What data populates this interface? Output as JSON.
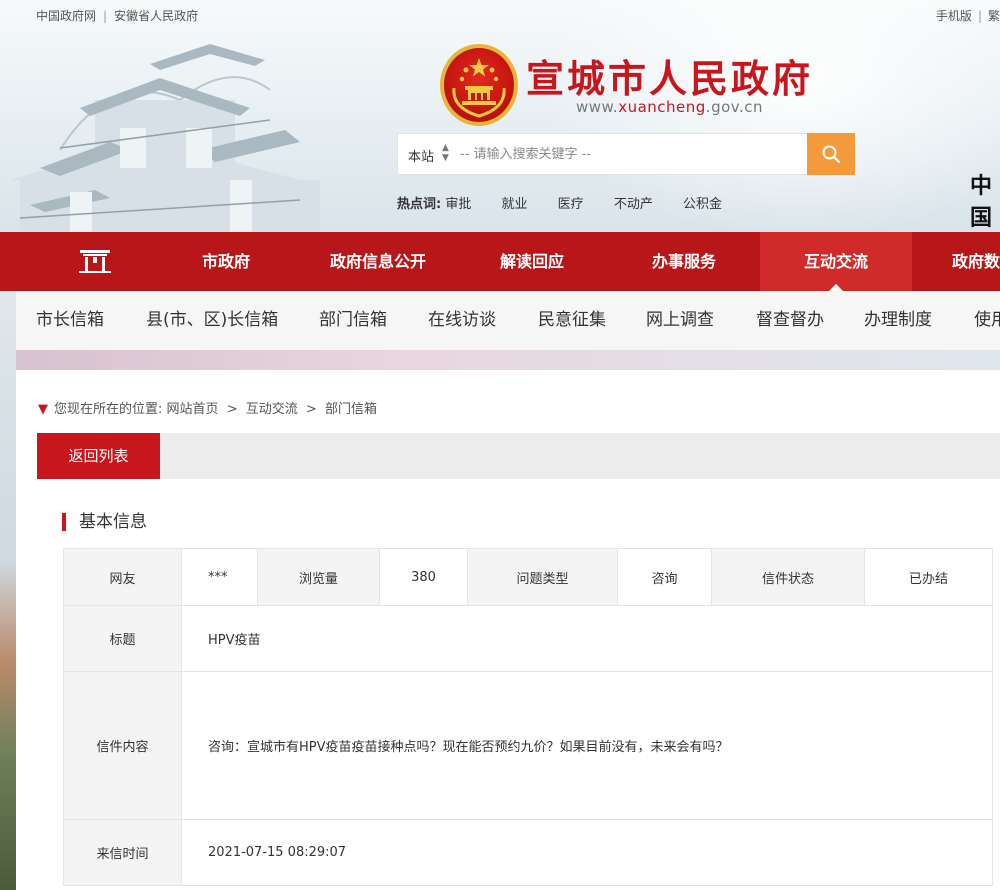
{
  "topbar": {
    "links": [
      "中国政府网",
      "安徽省人民政府"
    ],
    "right": [
      "手机版",
      "繁"
    ]
  },
  "site": {
    "title": "宣城市人民政府",
    "url_prefix": "www.",
    "url_brand": "xuancheng",
    "url_suffix": ".gov.cn",
    "side_text": "中国"
  },
  "search": {
    "scope": "本站",
    "placeholder": "-- 请输入搜索关键字 --"
  },
  "hot": {
    "label": "热点词:",
    "words": [
      "审批",
      "就业",
      "医疗",
      "不动产",
      "公积金"
    ]
  },
  "mainnav": {
    "items": [
      "市政府",
      "政府信息公开",
      "解读回应",
      "办事服务",
      "互动交流",
      "政府数"
    ],
    "active_index": 4
  },
  "subnav": {
    "items": [
      "市长信箱",
      "县(市、区)长信箱",
      "部门信箱",
      "在线访谈",
      "民意征集",
      "网上调查",
      "督查督办",
      "办理制度",
      "使用"
    ]
  },
  "breadcrumb": {
    "prefix": "您现在所在的位置:",
    "items": [
      "网站首页",
      "互动交流",
      "部门信箱"
    ],
    "separator": ">"
  },
  "back_button": "返回列表",
  "section_title": "基本信息",
  "table": {
    "netizen_label": "网友",
    "netizen_value": "***",
    "views_label": "浏览量",
    "views_value": "380",
    "type_label": "问题类型",
    "type_value": "咨询",
    "status_label": "信件状态",
    "status_value": "已办结",
    "title_label": "标题",
    "title_value": "HPV疫苗",
    "content_label": "信件内容",
    "content_value": "咨询：宣城市有HPV疫苗疫苗接种点吗？现在能否预约九价？如果目前没有，未来会有吗？",
    "time_label": "来信时间",
    "time_value": "2021-07-15 08:29:07"
  },
  "colors": {
    "brand_red": "#c8161d",
    "nav_red": "#b71719",
    "nav_active": "#d12a2b",
    "search_orange": "#f39a3a"
  }
}
